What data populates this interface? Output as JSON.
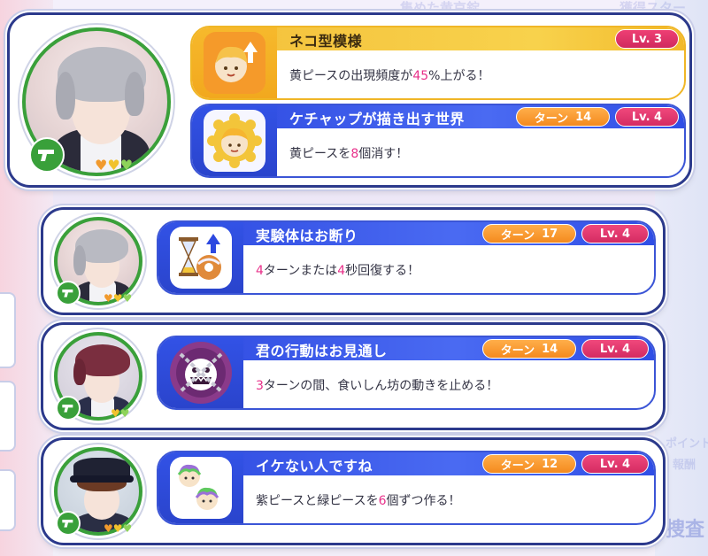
{
  "colors": {
    "blue_header": "#2d49e0",
    "yellow_header": "#f4c03a",
    "turn_pill": "#f48a1e",
    "level_pill": "#d42b62",
    "highlight_number": "#e8308a",
    "gun_badge": "#39a03a"
  },
  "background": {
    "ghost_text_1": "集めた黄京錠",
    "ghost_text_2": "獲得スター",
    "ghost_text_3": "ポイント",
    "ghost_text_4": "報酬",
    "ghost_text_5": "捜査"
  },
  "cards": [
    {
      "skills": [
        {
          "name": "ネコ型模様",
          "level": "Lv. 3",
          "desc_before": "黄ピースの出現頻度が",
          "desc_highlight": "45",
          "desc_after": "%上がる！",
          "icon": "piece-up-icon"
        },
        {
          "name": "ケチャップが描き出す世界",
          "turn_label": "ターン",
          "turn_value": "14",
          "level": "Lv. 4",
          "desc_before": "黄ピースを",
          "desc_highlight": "8",
          "desc_after": "個消す！",
          "icon": "yellow-piece-icon"
        }
      ]
    },
    {
      "skill": {
        "name": "実験体はお断り",
        "turn_label": "ターン",
        "turn_value": "17",
        "level": "Lv. 4",
        "desc_hl1": "4",
        "desc_mid": "ターンまたは",
        "desc_hl2": "4",
        "desc_after": "秒回復する！",
        "icon": "hourglass-donut-icon"
      }
    },
    {
      "skill": {
        "name": "君の行動はお見通し",
        "turn_label": "ターン",
        "turn_value": "14",
        "level": "Lv. 4",
        "desc_highlight": "3",
        "desc_after": "ターンの間、食いしん坊の動きを止める！",
        "icon": "chained-monster-icon"
      }
    },
    {
      "skill": {
        "name": "イケない人ですね",
        "turn_label": "ターン",
        "turn_value": "12",
        "level": "Lv. 4",
        "desc_before": "紫ピースと緑ピースを",
        "desc_highlight": "6",
        "desc_after": "個ずつ作る！",
        "icon": "rainbow-pieces-icon"
      }
    }
  ]
}
